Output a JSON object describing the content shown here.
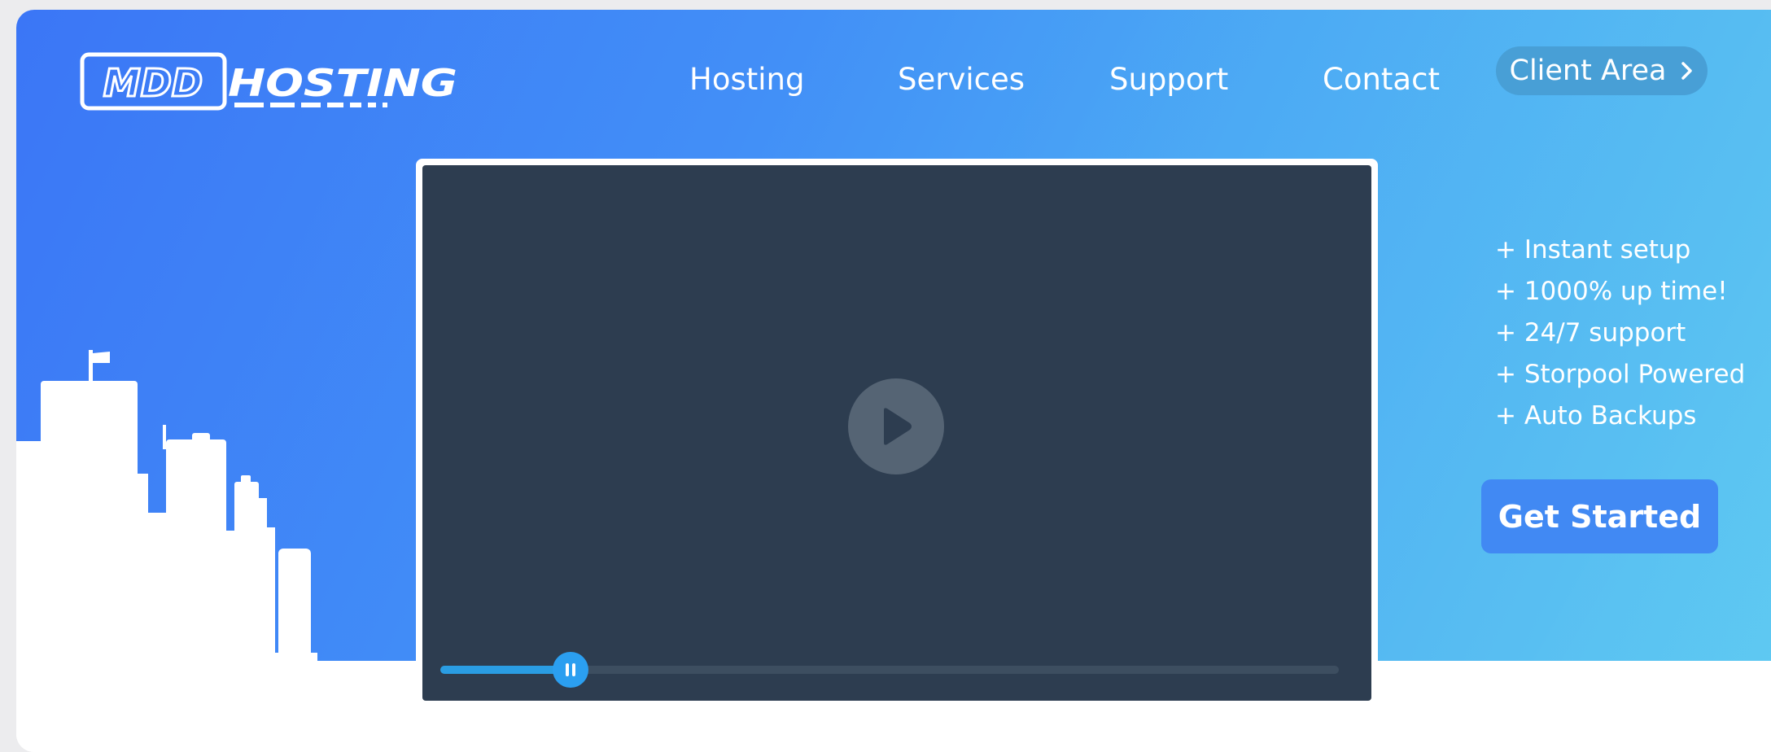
{
  "brand": {
    "logo_text": "MDD HOSTING",
    "colors": {
      "hero_start": "#3b76f6",
      "hero_end": "#56c6f1",
      "accent": "#2b9ff0"
    }
  },
  "nav": {
    "items": [
      {
        "label": "Hosting"
      },
      {
        "label": "Services"
      },
      {
        "label": "Support"
      },
      {
        "label": "Contact"
      }
    ],
    "client_area": {
      "label": "Client Area",
      "icon": "chevron-right-icon"
    }
  },
  "video": {
    "play_icon": "play-icon",
    "control_icon": "pause-icon",
    "progress": 0.145
  },
  "features": {
    "items": [
      "+ Instant setup",
      "+ 1000% up time!",
      "+ 24/7 support",
      "+ Storpool Powered",
      "+ Auto Backups"
    ]
  },
  "cta": {
    "label": "Get Started"
  },
  "decor": {
    "skyline_icon": "city-skyline-icon",
    "flag_icon": "flag-icon"
  }
}
